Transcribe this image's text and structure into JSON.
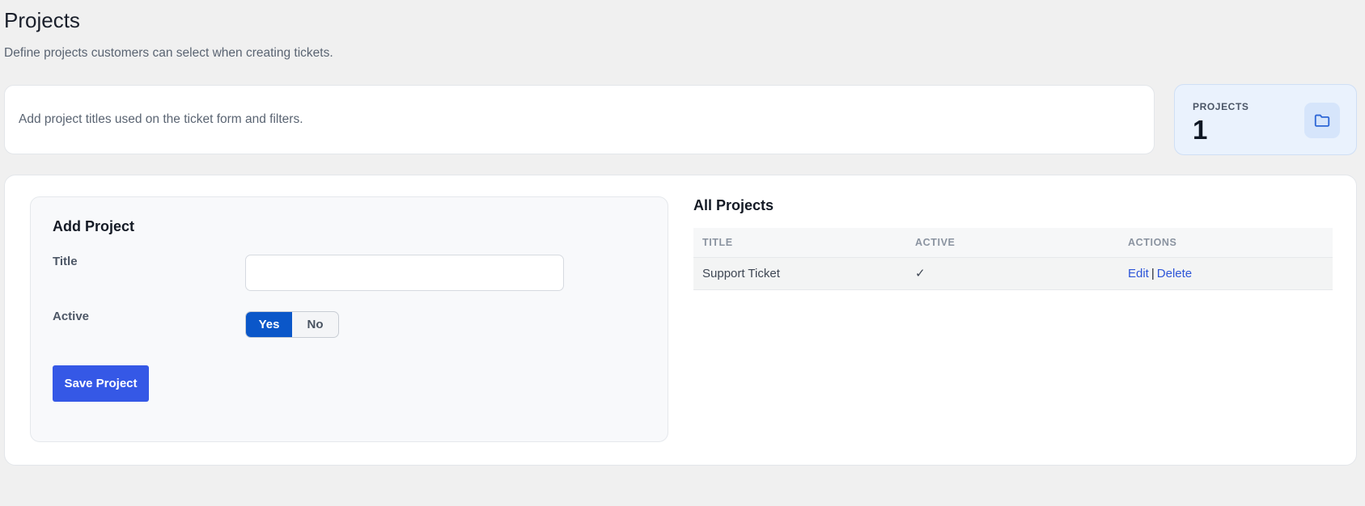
{
  "header": {
    "title": "Projects",
    "subtitle": "Define projects customers can select when creating tickets."
  },
  "intro": {
    "text": "Add project titles used on the ticket form and filters."
  },
  "stat": {
    "label": "PROJECTS",
    "value": "1",
    "icon": "folder-icon",
    "accent": "#2d66d6"
  },
  "form": {
    "title": "Add Project",
    "title_label": "Title",
    "title_value": "",
    "title_placeholder": "",
    "active_label": "Active",
    "active_options": [
      "Yes",
      "No"
    ],
    "active_selected": "Yes",
    "save_label": "Save Project"
  },
  "list": {
    "title": "All Projects",
    "columns": [
      "TITLE",
      "ACTIVE",
      "ACTIONS"
    ],
    "rows": [
      {
        "title": "Support Ticket",
        "active": "✓",
        "edit": "Edit",
        "sep": "|",
        "delete": "Delete"
      }
    ]
  },
  "colors": {
    "primary_button": "#3558e6",
    "toggle_active": "#0b57c9",
    "link": "#2d55d8"
  }
}
